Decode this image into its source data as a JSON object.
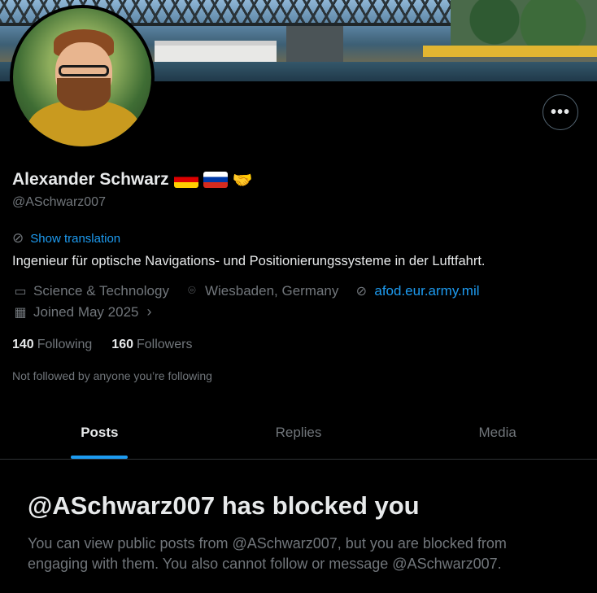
{
  "profile": {
    "name": "Alexander Schwarz",
    "handle": "@ASchwarz007",
    "flags": [
      "flag-de-icon",
      "flag-ru-icon",
      "handshake-icon"
    ],
    "show_translation": "Show translation",
    "bio": "Ingenieur für optische Navigations- und Positionierungssysteme in der Luftfahrt.",
    "category": "Science & Technology",
    "location": "Wiesbaden, Germany",
    "website": "afod.eur.army.mil",
    "joined": "Joined May 2025",
    "following_count": "140",
    "following_label": "Following",
    "followers_count": "160",
    "followers_label": "Followers",
    "not_followed": "Not followed by anyone you’re following"
  },
  "tabs": [
    {
      "label": "Posts",
      "active": true
    },
    {
      "label": "Replies",
      "active": false
    },
    {
      "label": "Media",
      "active": false
    }
  ],
  "blocked": {
    "title": "@ASchwarz007 has blocked you",
    "description": "You can view public posts from @ASchwarz007, but you are blocked from engaging with them. You also cannot follow or message @ASchwarz007."
  },
  "colors": {
    "accent": "#1d9bf0",
    "secondary_text": "#71767b",
    "primary_text": "#e7e9ea",
    "background": "#000000"
  }
}
